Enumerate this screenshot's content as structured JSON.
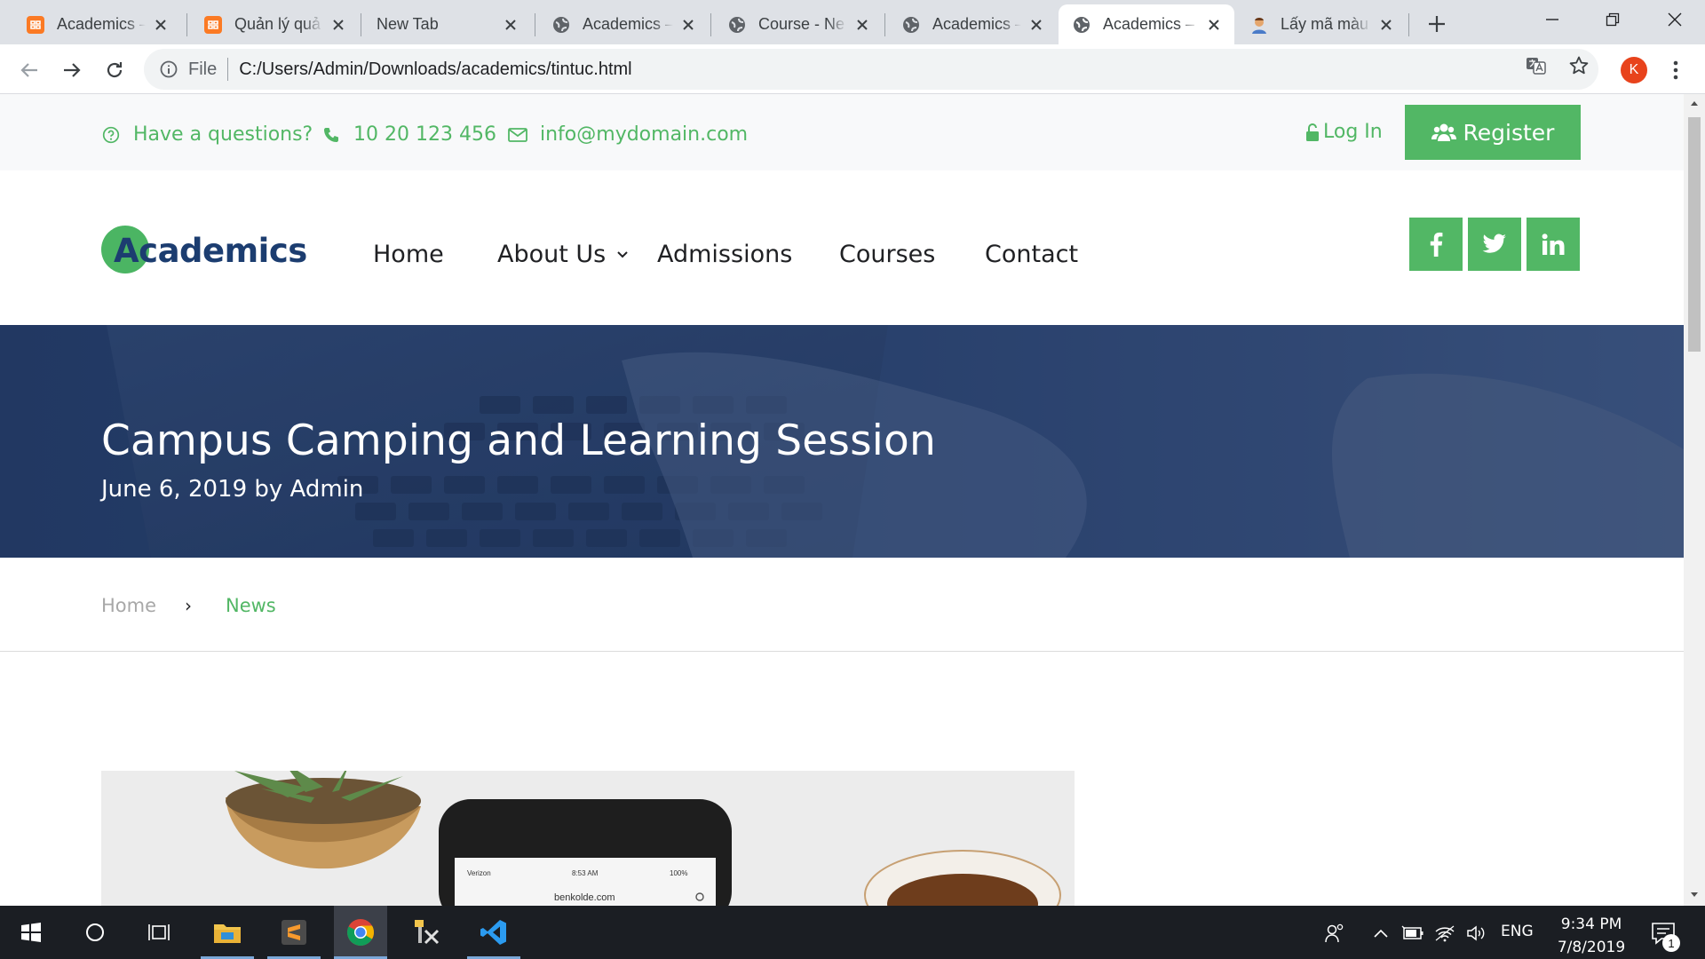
{
  "browser": {
    "tabs": [
      {
        "label": "Academics –",
        "favicon": "xampp-icon",
        "active": false
      },
      {
        "label": "Quản lý quả",
        "favicon": "xampp-icon",
        "active": false
      },
      {
        "label": "New Tab",
        "favicon": "",
        "active": false
      },
      {
        "label": "Academics –",
        "favicon": "globe-icon",
        "active": false
      },
      {
        "label": "Course - Ne",
        "favicon": "globe-icon",
        "active": false
      },
      {
        "label": "Academics –",
        "favicon": "globe-icon",
        "active": false
      },
      {
        "label": "Academics –",
        "favicon": "globe-icon",
        "active": true
      },
      {
        "label": "Lấy mã màu",
        "favicon": "avatar-icon",
        "active": false
      }
    ],
    "address": {
      "scheme_label": "File",
      "url": "C:/Users/Admin/Downloads/academics/tintuc.html"
    },
    "profile_initial": "K"
  },
  "site": {
    "topbar": {
      "question": "Have a questions?",
      "phone": "10 20 123 456",
      "email": "info@mydomain.com",
      "login": "Log In",
      "register": "Register"
    },
    "logo": "Academics",
    "menu": [
      "Home",
      "About Us",
      "Admissions",
      "Courses",
      "Contact"
    ],
    "social": [
      "facebook-icon",
      "twitter-icon",
      "linkedin-icon"
    ],
    "hero": {
      "title": "Campus Camping and Learning Session",
      "meta": "June 6, 2019 by Admin"
    },
    "breadcrumb": {
      "home": "Home",
      "separator": "›",
      "current": "News"
    },
    "image_texts": {
      "status_carrier": "Verizon",
      "status_time": "8:53 AM",
      "status_battery": "100%",
      "address_bar": "benkolde.com"
    }
  },
  "taskbar": {
    "language": "ENG",
    "time": "9:34 PM",
    "date": "7/8/2019",
    "notifications": "1"
  },
  "colors": {
    "accent": "#52b765",
    "logo_text": "#1c3d70",
    "hero_overlay": "#2b4573"
  }
}
